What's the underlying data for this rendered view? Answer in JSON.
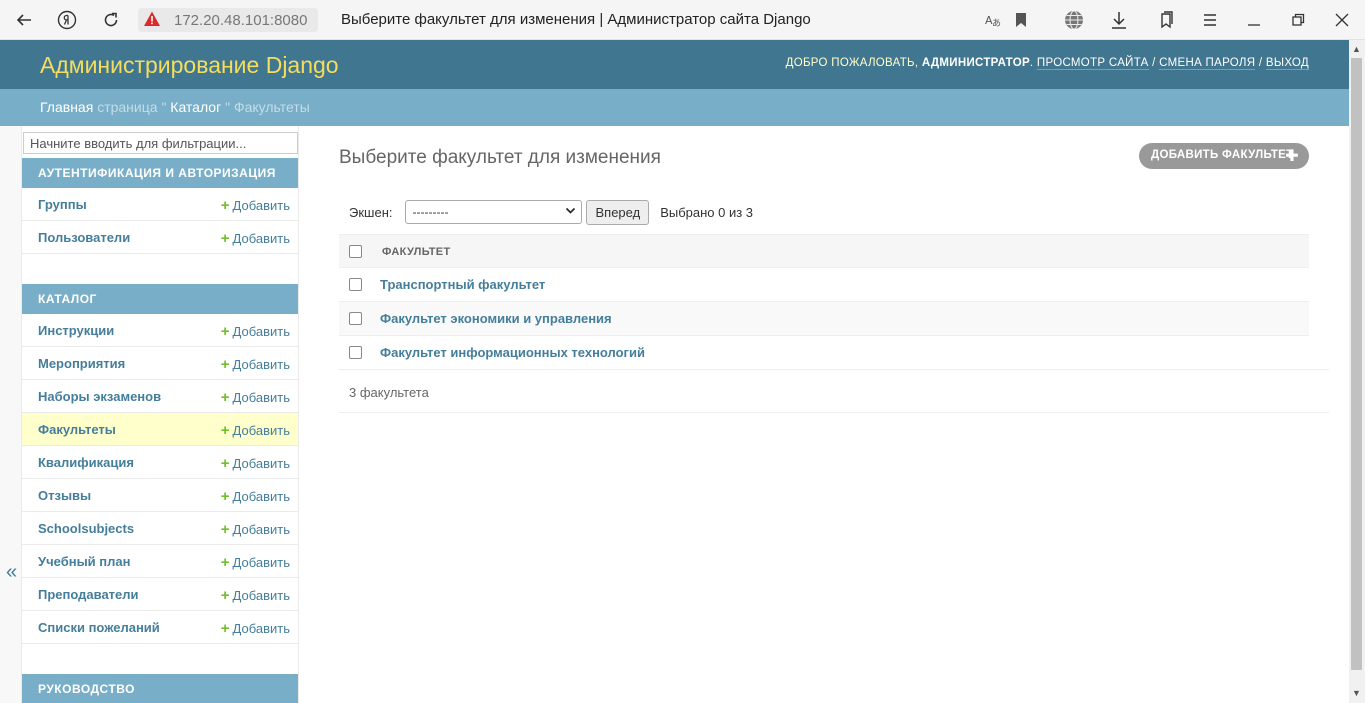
{
  "browser": {
    "url": "172.20.48.101:8080",
    "tab_title": "Выберите факультет для изменения | Администратор сайта Django",
    "icons": [
      "back-icon",
      "yandex-icon",
      "reload-icon",
      "warning-icon",
      "translate-icon",
      "bookmark-icon",
      "globe-icon",
      "download-icon",
      "collections-icon",
      "menu-icon",
      "minimize-icon",
      "restore-icon",
      "close-icon"
    ]
  },
  "header": {
    "branding": "Администрирование Django",
    "welcome": "ДОБРО ПОЖАЛОВАТЬ,",
    "username": "АДМИНИСТРАТОР",
    "view_site": "ПРОСМОТР САЙТА",
    "change_password": "СМЕНА ПАРОЛЯ",
    "logout": "ВЫХОД"
  },
  "breadcrumbs": {
    "home": "Главная",
    "home_rest": "страница",
    "sep": "\"",
    "app": "Каталог",
    "current": "Факультеты"
  },
  "sidebar": {
    "filter_placeholder": "Начните вводить для фильтрации...",
    "toggle": "«",
    "add_label": "Добавить",
    "modules": [
      {
        "caption": "АУТЕНТИФИКАЦИЯ И АВТОРИЗАЦИЯ",
        "items": [
          "Группы",
          "Пользователи"
        ]
      },
      {
        "caption": "КАТАЛОГ",
        "items": [
          "Инструкции",
          "Мероприятия",
          "Наборы экзаменов",
          "Факультеты",
          "Квалификация",
          "Отзывы",
          "Schoolsubjects",
          "Учебный план",
          "Преподаватели",
          "Списки пожеланий"
        ]
      },
      {
        "caption": "РУКОВОДСТВО",
        "items": []
      }
    ],
    "current_item": "Факультеты"
  },
  "content": {
    "title": "Выберите факультет для изменения",
    "add_button": "ДОБАВИТЬ ФАКУЛЬТЕТ",
    "action_label": "Экшен:",
    "action_selected": "---------",
    "go_button": "Вперед",
    "counter": "Выбрано 0 из 3",
    "column_header": "ФАКУЛЬТЕТ",
    "rows": [
      "Транспортный факультет",
      "Факультет экономики и управления",
      "Факультет информационных технологий"
    ],
    "paginator": "3 факультета"
  },
  "colors": {
    "header": "#417690",
    "breadcrumbs": "#79aec8",
    "branding": "#f5dd5d",
    "link": "#447e9b",
    "add_plus": "#70bf2b",
    "current_row": "#ffffcc"
  }
}
